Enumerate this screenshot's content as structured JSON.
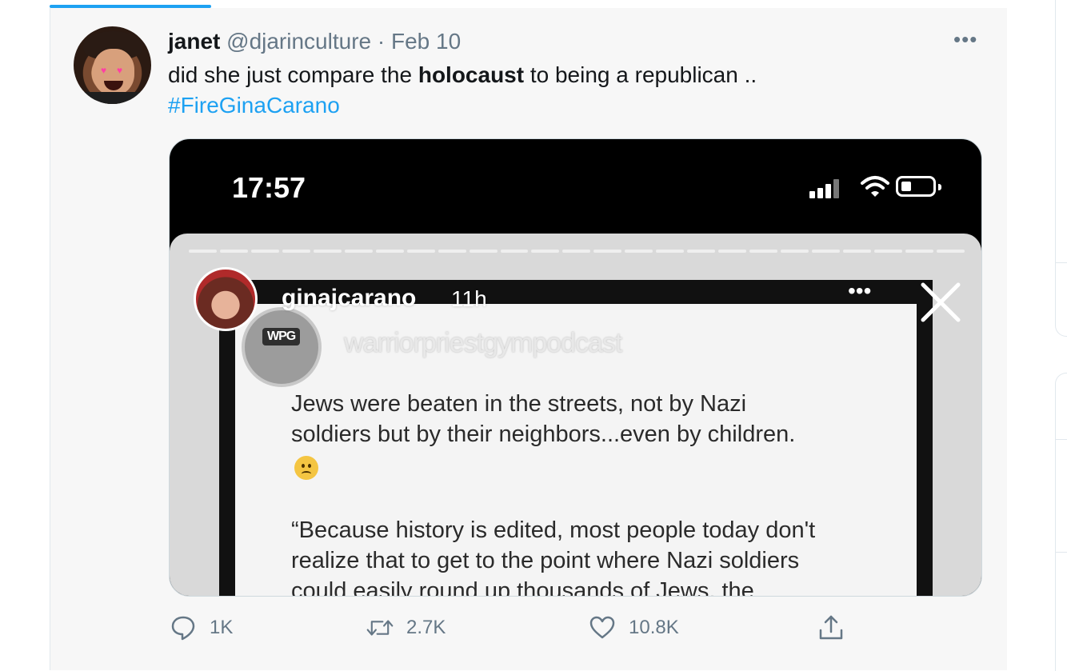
{
  "tweet": {
    "display_name": "janet",
    "handle": "@djarinculture",
    "separator": " · ",
    "date": "Feb 10",
    "text_before": "did she just compare the ",
    "text_bold": "holocaust",
    "text_after": " to being a republican ..",
    "hashtag": "#FireGinaCarano"
  },
  "screenshot": {
    "status_time": "17:57",
    "story_username": "ginajcarano",
    "story_age": "11h",
    "progress_segments": 25,
    "post": {
      "logo_text": "WPG",
      "watermark": "warriorpriestgympodcast",
      "line1": "Jews were beaten in the streets, not by Nazi",
      "line2": "soldiers but by their neighbors...even by children.",
      "line3": "“Because history is edited, most people today don't",
      "line4": "realize that to get to the point where Nazi soldiers",
      "line5": "could easily round up thousands of Jews, the"
    }
  },
  "actions": {
    "reply_count": "1K",
    "retweet_count": "2.7K",
    "like_count": "10.8K"
  },
  "colors": {
    "accent": "#1da1f2",
    "muted": "#657786",
    "text": "#14171a"
  },
  "icons": [
    "more-icon",
    "reply-icon",
    "retweet-icon",
    "like-icon",
    "share-icon",
    "wifi-icon",
    "signal-icon",
    "battery-icon",
    "close-icon"
  ]
}
